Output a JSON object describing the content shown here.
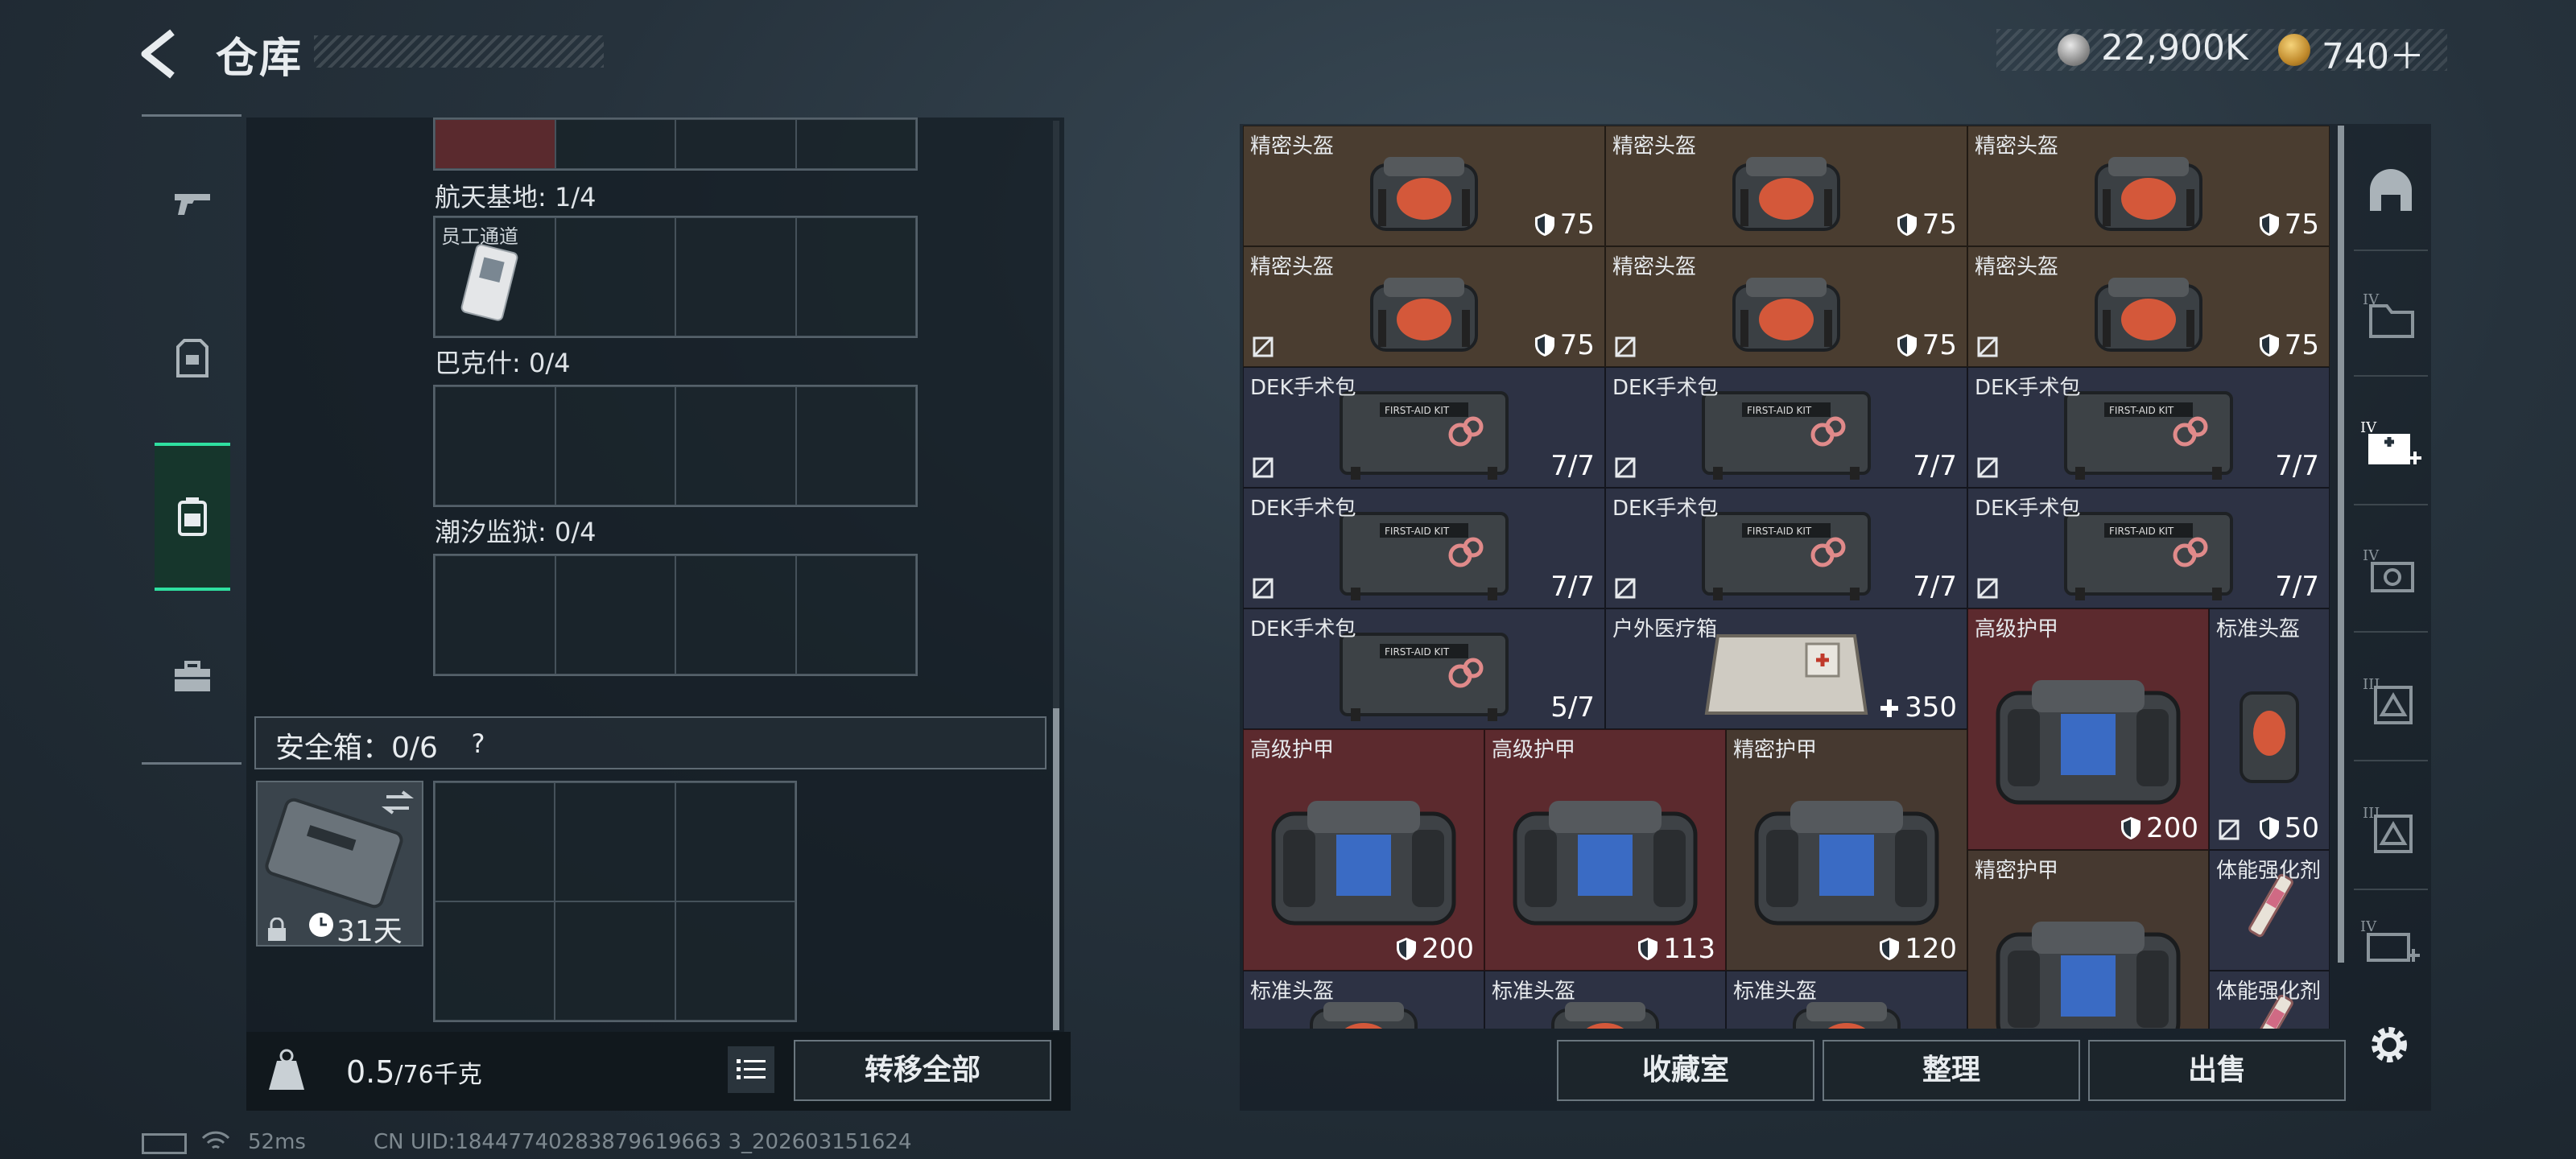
{
  "header": {
    "title": "仓库",
    "currency_silver": "22,900K",
    "currency_gold": "740＋"
  },
  "left_tabs": [
    {
      "name": "weapons-tab",
      "icon": "gun-icon"
    },
    {
      "name": "equipment-tab",
      "icon": "vest-icon"
    },
    {
      "name": "backpack-tab",
      "icon": "backpack-icon",
      "active": true
    },
    {
      "name": "toolbox-tab",
      "icon": "toolbox-icon"
    }
  ],
  "collections": {
    "key_sections": [
      {
        "label": "航天基地: 1/4",
        "items": [
          {
            "name": "员工通道"
          }
        ]
      },
      {
        "label": "巴克什: 0/4",
        "items": []
      },
      {
        "label": "潮汐监狱: 0/4",
        "items": []
      }
    ]
  },
  "safe": {
    "label": "安全箱：0/6",
    "help": "?",
    "days": "31天"
  },
  "weight": {
    "value": "0.5",
    "max": "/76千克"
  },
  "buttons": {
    "transfer_all": "转移全部",
    "collection_room": "收藏室",
    "organize": "整理",
    "sell": "出售"
  },
  "status": {
    "ping": "52ms",
    "uid": "CN UID:18447740283879619663 3_202603151624"
  },
  "inventory": [
    {
      "name": "精密头盔",
      "value": "75",
      "kind": "helmet"
    },
    {
      "name": "精密头盔",
      "value": "75",
      "kind": "helmet"
    },
    {
      "name": "精密头盔",
      "value": "75",
      "kind": "helmet"
    },
    {
      "name": "精密头盔",
      "value": "75",
      "kind": "helmet",
      "locked": true
    },
    {
      "name": "精密头盔",
      "value": "75",
      "kind": "helmet",
      "locked": true
    },
    {
      "name": "精密头盔",
      "value": "75",
      "kind": "helmet",
      "locked": true
    },
    {
      "name": "DEK手术包",
      "value": "7/7",
      "kind": "medkit",
      "locked": true
    },
    {
      "name": "DEK手术包",
      "value": "7/7",
      "kind": "medkit",
      "locked": true
    },
    {
      "name": "DEK手术包",
      "value": "7/7",
      "kind": "medkit",
      "locked": true
    },
    {
      "name": "DEK手术包",
      "value": "7/7",
      "kind": "medkit",
      "locked": true
    },
    {
      "name": "DEK手术包",
      "value": "7/7",
      "kind": "medkit",
      "locked": true
    },
    {
      "name": "DEK手术包",
      "value": "7/7",
      "kind": "medkit",
      "locked": true
    },
    {
      "name": "DEK手术包",
      "value": "5/7",
      "kind": "medkit"
    },
    {
      "name": "户外医疗箱",
      "value": "350",
      "kind": "medbox"
    },
    {
      "name": "高级护甲",
      "value": "200",
      "kind": "armor"
    },
    {
      "name": "标准头盔",
      "value": "50",
      "kind": "helmet-small",
      "locked": true
    },
    {
      "name": "高级护甲",
      "value": "200",
      "kind": "armor"
    },
    {
      "name": "高级护甲",
      "value": "113",
      "kind": "armor"
    },
    {
      "name": "精密护甲",
      "value": "120",
      "kind": "armor"
    },
    {
      "name": "精密护甲",
      "value": "",
      "kind": "armor"
    },
    {
      "name": "体能强化剂",
      "value": "",
      "kind": "syringe"
    },
    {
      "name": "标准头盔",
      "value": "",
      "kind": "helmet"
    },
    {
      "name": "标准头盔",
      "value": "",
      "kind": "helmet"
    },
    {
      "name": "标准头盔",
      "value": "",
      "kind": "helmet"
    },
    {
      "name": "体能强化剂",
      "value": "",
      "kind": "syringe"
    }
  ],
  "right_tabs": [
    {
      "name": "helmet-storage-tab",
      "icon": "helmet-icon"
    },
    {
      "name": "tier-iv-folder-tab",
      "icon": "folder-icon",
      "tier": "IV"
    },
    {
      "name": "tier-iv-medical-tab",
      "icon": "medical-icon",
      "tier": "IV"
    },
    {
      "name": "tier-iv-camera-tab",
      "icon": "camera-icon",
      "tier": "IV"
    },
    {
      "name": "tier-iii-doc-tab",
      "icon": "document-icon",
      "tier": "III"
    },
    {
      "name": "tier-iii-doc2-tab",
      "icon": "document-icon",
      "tier": "III"
    },
    {
      "name": "tier-iv-card-tab",
      "icon": "card-icon",
      "tier": "IV"
    }
  ],
  "colors": {
    "accent": "#2fe0a0",
    "item_brown": "#4a3d30",
    "item_navy": "#2d3244",
    "item_red": "#5c2a2e"
  }
}
